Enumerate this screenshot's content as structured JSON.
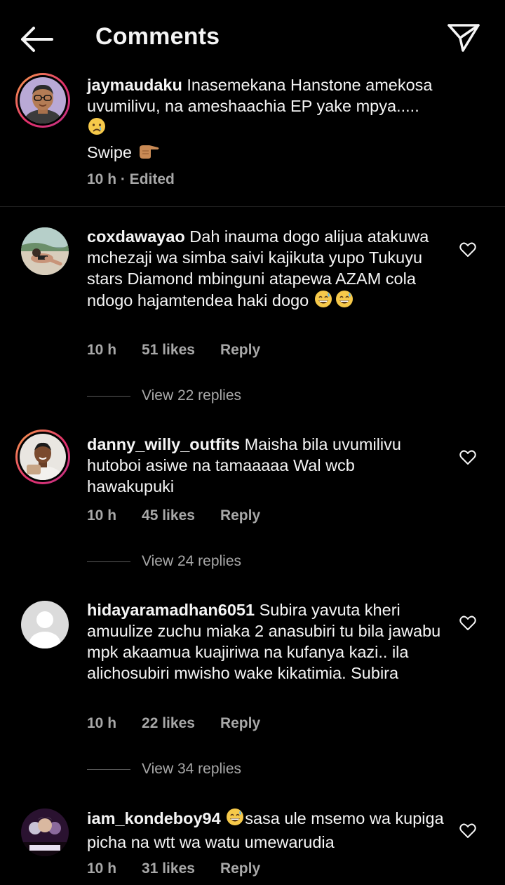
{
  "header": {
    "title": "Comments"
  },
  "caption": {
    "username": "jaymaudaku",
    "text": "Inasemekana Hanstone amekosa uvumilivu, na ameshaachia EP yake mpya.....",
    "line3": "Swipe",
    "meta": "10 h · Edited"
  },
  "comments": [
    {
      "username": "coxdawayao",
      "text": "Dah inauma dogo alijua atakuwa mchezaji wa simba saivi kajikuta yupo Tukuyu stars Diamond mbinguni atapewa AZAM cola ndogo hajamtendea haki dogo",
      "time": "10 h",
      "likes": "51 likes",
      "reply": "Reply",
      "view_replies": "View 22 replies"
    },
    {
      "username": "danny_willy_outfits",
      "text": "Maisha bila uvumilivu hutoboi asiwe na tamaaaaa Wal wcb hawakupuki",
      "time": "10 h",
      "likes": "45 likes",
      "reply": "Reply",
      "view_replies": "View 24 replies"
    },
    {
      "username": "hidayaramadhan6051",
      "text": "Subira yavuta kheri amuulize zuchu miaka 2 anasubiri tu bila jawabu mpk akaamua kuajiriwa na kufanya kazi.. ila alichosubiri mwisho wake kikatimia. Subira",
      "time": "10 h",
      "likes": "22 likes",
      "reply": "Reply",
      "view_replies": "View 34 replies"
    },
    {
      "username": "iam_kondeboy94",
      "text": "sasa ule msemo wa kupiga picha na wtt wa watu umewarudia",
      "time": "10 h",
      "likes": "31 likes",
      "reply": "Reply"
    }
  ],
  "icons": {
    "back": "back-arrow-icon",
    "send": "paper-plane-icon",
    "like": "heart-outline-icon",
    "crying": "crying-face-emoji",
    "pointing": "pointing-right-emoji",
    "laughing": "grinning-sweat-emoji"
  },
  "colors": {
    "background": "#000000",
    "text": "#f5f5f5",
    "secondary_text": "#a8a8a8",
    "story_ring": "#e1306c"
  }
}
